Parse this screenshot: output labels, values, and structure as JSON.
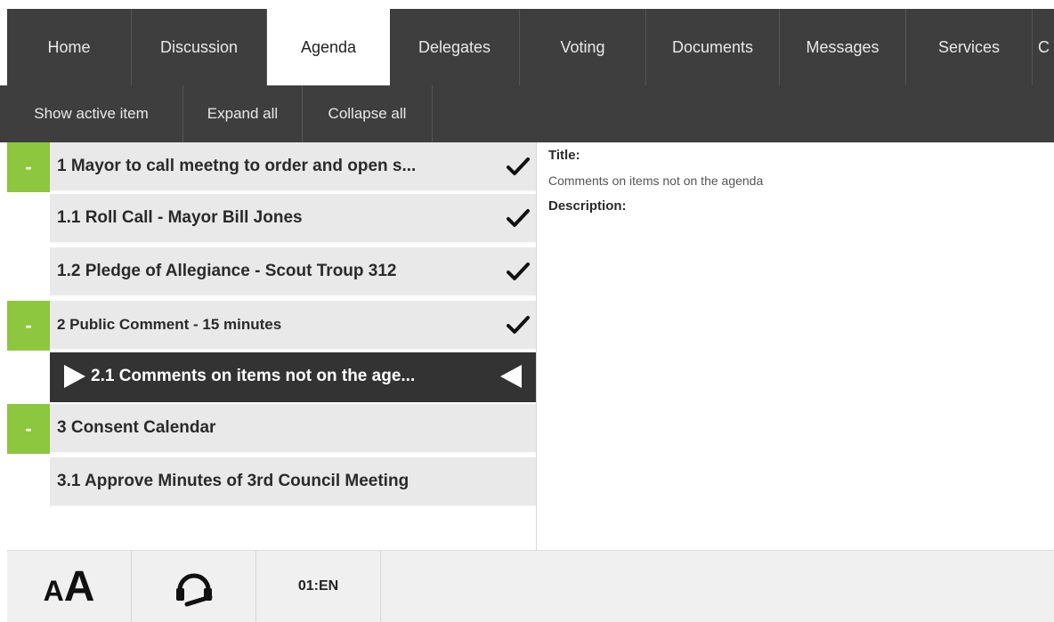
{
  "nav": {
    "tabs": [
      {
        "label": "Home"
      },
      {
        "label": "Discussion"
      },
      {
        "label": "Agenda",
        "active": true
      },
      {
        "label": "Delegates"
      },
      {
        "label": "Voting"
      },
      {
        "label": "Documents"
      },
      {
        "label": "Messages"
      },
      {
        "label": "Services"
      },
      {
        "label": "C"
      }
    ]
  },
  "toolbar": {
    "show_active": "Show active item",
    "expand_all": "Expand all",
    "collapse_all": "Collapse all"
  },
  "agenda": {
    "items": [
      {
        "label": "1 Mayor to call meetng to order and open s...",
        "toggle": "-",
        "checked": true
      },
      {
        "label": "1.1 Roll Call - Mayor Bill Jones",
        "checked": true
      },
      {
        "label": "1.2 Pledge of Allegiance - Scout Troup 312",
        "checked": true
      },
      {
        "label": "2 Public Comment - 15 minutes",
        "toggle": "-",
        "checked": true
      },
      {
        "label": "2.1 Comments on items not on the age...",
        "active": true
      },
      {
        "label": "3 Consent Calendar",
        "toggle": "-"
      },
      {
        "label": "3.1 Approve Minutes of 3rd Council Meeting"
      }
    ]
  },
  "detail": {
    "title_label": "Title:",
    "title_value": "Comments on items not on the agenda",
    "description_label": "Description:"
  },
  "footer": {
    "text_size_small": "A",
    "text_size_big": "A",
    "language": "01:EN"
  },
  "colors": {
    "bar": "#3e3e3e",
    "accent_green": "#8dc63f",
    "active_row": "#333333"
  },
  "icons": [
    "check-icon",
    "play-right-icon",
    "play-left-icon",
    "headset-icon"
  ]
}
